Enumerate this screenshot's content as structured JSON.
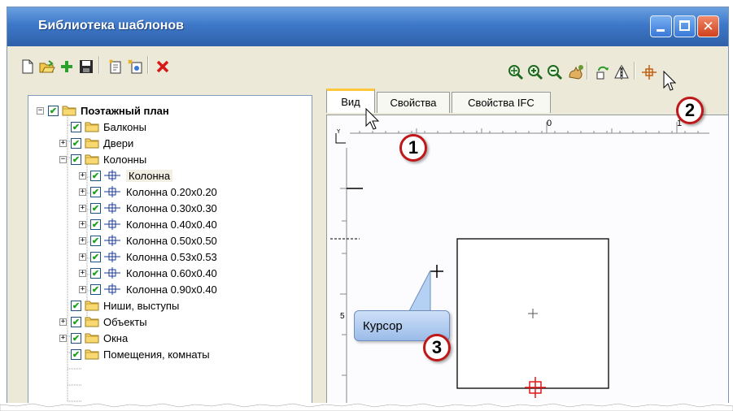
{
  "window": {
    "title": "Библиотека шаблонов",
    "controls": {
      "minimize": "minimize",
      "maximize": "maximize",
      "close": "close"
    }
  },
  "toolbar_left": [
    {
      "name": "new-icon",
      "glyph": "🗋"
    },
    {
      "name": "open-icon",
      "glyph": "📂"
    },
    {
      "name": "add-icon",
      "glyph": "+"
    },
    {
      "name": "save-icon",
      "glyph": "💾"
    },
    {
      "name": "new-template-icon",
      "glyph": "📋"
    },
    {
      "name": "new-from-icon",
      "glyph": "✨"
    },
    {
      "name": "delete-icon",
      "glyph": "✕"
    }
  ],
  "toolbar_right": [
    {
      "name": "zoom-extent-icon"
    },
    {
      "name": "zoom-in-icon"
    },
    {
      "name": "zoom-out-icon"
    },
    {
      "name": "pan-icon"
    },
    {
      "name": "rotate-icon"
    },
    {
      "name": "mirror-icon"
    },
    {
      "name": "base-point-icon"
    }
  ],
  "tree": {
    "items": [
      {
        "label": "Поэтажный план",
        "bold": true,
        "expander": "−",
        "checked": true,
        "icon": "folder"
      },
      {
        "label": "Балконы",
        "checked": true,
        "icon": "folder"
      },
      {
        "label": "Двери",
        "expander": "+",
        "checked": true,
        "icon": "folder"
      },
      {
        "label": "Колонны",
        "expander": "−",
        "checked": true,
        "icon": "folder"
      },
      {
        "label": "Колонна",
        "expander": "+",
        "checked": true,
        "icon": "column",
        "selected": true
      },
      {
        "label": "Колонна 0.20x0.20",
        "expander": "+",
        "checked": true,
        "icon": "column"
      },
      {
        "label": "Колонна 0.30x0.30",
        "expander": "+",
        "checked": true,
        "icon": "column"
      },
      {
        "label": "Колонна 0.40x0.40",
        "expander": "+",
        "checked": true,
        "icon": "column"
      },
      {
        "label": "Колонна 0.50x0.50",
        "expander": "+",
        "checked": true,
        "icon": "column"
      },
      {
        "label": "Колонна 0.53x0.53",
        "expander": "+",
        "checked": true,
        "icon": "column"
      },
      {
        "label": "Колонна 0.60x0.40",
        "expander": "+",
        "checked": true,
        "icon": "column"
      },
      {
        "label": "Колонна 0.90x0.40",
        "expander": "+",
        "checked": true,
        "icon": "column"
      },
      {
        "label": "Ниши, выступы",
        "checked": true,
        "icon": "folder"
      },
      {
        "label": "Объекты",
        "expander": "+",
        "checked": true,
        "icon": "folder"
      },
      {
        "label": "Окна",
        "expander": "+",
        "checked": true,
        "icon": "folder"
      },
      {
        "label": "Помещения, комнаты",
        "checked": true,
        "icon": "folder"
      }
    ]
  },
  "tabs": [
    {
      "label": "Вид",
      "active": true
    },
    {
      "label": "Свойства",
      "active": false
    },
    {
      "label": "Свойства IFC",
      "active": false
    }
  ],
  "ruler": {
    "marks": [
      "0",
      "1"
    ],
    "side_mark": "5"
  },
  "callout": {
    "text": "Курсор"
  },
  "badges": [
    "1",
    "2",
    "3"
  ],
  "colors": {
    "title_bar": "#3d78c8",
    "callout_fill": "#b4d0f2",
    "badge_border": "#c01818",
    "base_point": "#e01818"
  }
}
